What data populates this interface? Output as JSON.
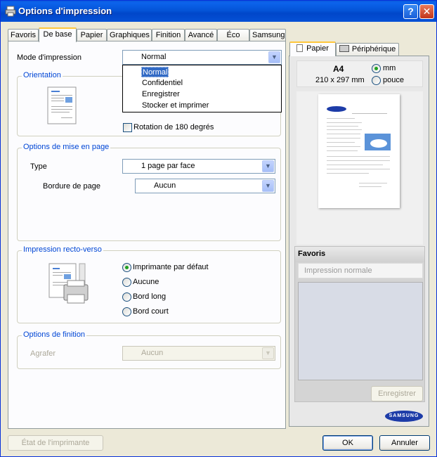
{
  "window": {
    "title": "Options d'impression"
  },
  "tabs": [
    "Favoris",
    "De base",
    "Papier",
    "Graphiques",
    "Finition",
    "Avancé",
    "Éco",
    "Samsung"
  ],
  "print_mode": {
    "label": "Mode d'impression",
    "value": "Normal",
    "options": [
      "Normal",
      "Confidentiel",
      "Enregistrer",
      "Stocker et imprimer"
    ]
  },
  "orientation": {
    "title": "Orientation",
    "rotate_label": "Rotation de 180 degrés"
  },
  "layout": {
    "title": "Options de mise en page",
    "type_label": "Type",
    "type_value": "1 page par face",
    "border_label": "Bordure de page",
    "border_value": "Aucun"
  },
  "duplex": {
    "title": "Impression recto-verso",
    "options": [
      "Imprimante par défaut",
      "Aucune",
      "Bord long",
      "Bord court"
    ],
    "selected": "Imprimante par défaut"
  },
  "finishing": {
    "title": "Options de finition",
    "staple_label": "Agrafer",
    "staple_value": "Aucun"
  },
  "right_panel": {
    "tabs": [
      "Papier",
      "Périphérique"
    ],
    "paper_size": "A4",
    "paper_dims": "210 x 297 mm",
    "units": [
      "mm",
      "pouce"
    ],
    "unit_selected": "mm",
    "favorites_title": "Favoris",
    "favorites_placeholder": "Impression normale",
    "save_label": "Enregistrer",
    "brand": "SAMSUNG"
  },
  "footer": {
    "printer_status": "État de l'imprimante",
    "ok": "OK",
    "cancel": "Annuler"
  }
}
